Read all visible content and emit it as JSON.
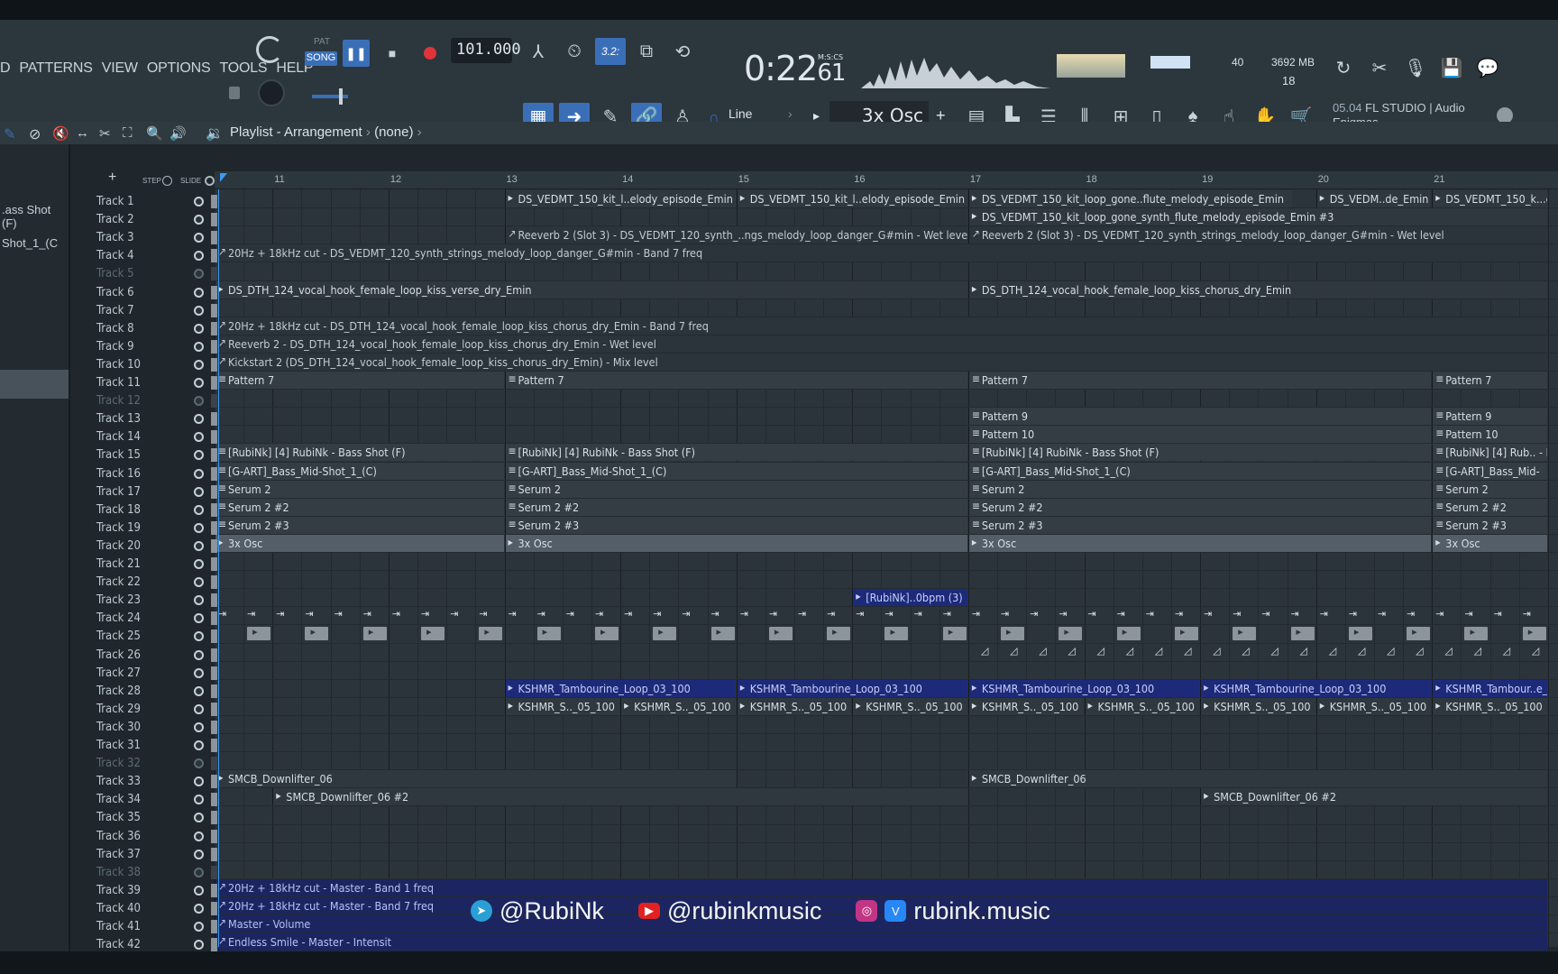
{
  "menu": [
    "D",
    "PATTERNS",
    "VIEW",
    "OPTIONS",
    "TOOLS",
    "HELP"
  ],
  "transport": {
    "pat_label": "PAT",
    "song_label": "SONG",
    "tempo": "101.000",
    "time_main": "0:22",
    "time_frac": "61",
    "time_unit": "M:S:CS"
  },
  "monitor": {
    "cpu_value": "40",
    "mem_value": "3692 MB",
    "poly_value": "18"
  },
  "snap": {
    "mode": "Line",
    "current_pattern": "3x Osc"
  },
  "hint": {
    "version": "05.04",
    "product": "FL STUDIO | Audio",
    "author": "Enigmas"
  },
  "playlist": {
    "title": "Playlist - Arrangement",
    "breadcrumb": "(none)",
    "step_label": "STEP",
    "slide_label": "SLIDE"
  },
  "browser": {
    "item1": ".ass Shot (F)",
    "item2": "Shot_1_(C"
  },
  "ruler": [
    "11",
    "12",
    "13",
    "14",
    "15",
    "16",
    "17",
    "18",
    "19",
    "20",
    "21"
  ],
  "tracks": [
    "Track 1",
    "Track 2",
    "Track 3",
    "Track 4",
    "Track 5",
    "Track 6",
    "Track 7",
    "Track 8",
    "Track 9",
    "Track 10",
    "Track 11",
    "Track 12",
    "Track 13",
    "Track 14",
    "Track 15",
    "Track 16",
    "Track 17",
    "Track 18",
    "Track 19",
    "Track 20",
    "Track 21",
    "Track 22",
    "Track 23",
    "Track 24",
    "Track 25",
    "Track 26",
    "Track 27",
    "Track 28",
    "Track 29",
    "Track 30",
    "Track 31",
    "Track 32",
    "Track 33",
    "Track 34",
    "Track 35",
    "Track 36",
    "Track 37",
    "Track 38",
    "Track 39",
    "Track 40",
    "Track 41",
    "Track 42"
  ],
  "dim_tracks": [
    5,
    12,
    32,
    38
  ],
  "clips": [
    {
      "row": 1,
      "start": 13,
      "end": 15,
      "kind": "audio",
      "label": "DS_VEDMT_150_kit_l..elody_episode_Emin"
    },
    {
      "row": 1,
      "start": 15,
      "end": 17,
      "kind": "audio",
      "label": "DS_VEDMT_150_kit_l..elody_episode_Emin"
    },
    {
      "row": 1,
      "start": 17,
      "end": 19.8,
      "kind": "audio",
      "label": "DS_VEDMT_150_kit_loop_gone..flute_melody_episode_Emin"
    },
    {
      "row": 1,
      "start": 20,
      "end": 21,
      "kind": "audio",
      "label": "DS_VEDM..de_Emin"
    },
    {
      "row": 1,
      "start": 21,
      "end": 22,
      "kind": "audio",
      "label": "DS_VEDMT_150_k...el"
    },
    {
      "row": 2,
      "start": 17,
      "end": 22,
      "kind": "audio",
      "label": "DS_VEDMT_150_kit_loop_gone_synth_flute_melody_episode_Emin #3"
    },
    {
      "row": 3,
      "start": 13,
      "end": 17,
      "kind": "auto",
      "label": "Reeverb 2 (Slot 3) - DS_VEDMT_120_synth_..ngs_melody_loop_danger_G#min - Wet level"
    },
    {
      "row": 3,
      "start": 17,
      "end": 22,
      "kind": "auto",
      "label": "Reeverb 2 (Slot 3) - DS_VEDMT_120_synth_strings_melody_loop_danger_G#min - Wet level"
    },
    {
      "row": 4,
      "start": 10.5,
      "end": 22,
      "kind": "auto",
      "label": "20Hz + 18kHz cut - DS_VEDMT_120_synth_strings_melody_loop_danger_G#min - Band 7 freq"
    },
    {
      "row": 6,
      "start": 10.5,
      "end": 17,
      "kind": "audio",
      "label": "DS_DTH_124_vocal_hook_female_loop_kiss_verse_dry_Emin"
    },
    {
      "row": 6,
      "start": 17,
      "end": 22,
      "kind": "audio",
      "label": "DS_DTH_124_vocal_hook_female_loop_kiss_chorus_dry_Emin"
    },
    {
      "row": 8,
      "start": 10.5,
      "end": 22,
      "kind": "auto",
      "label": "20Hz + 18kHz cut - DS_DTH_124_vocal_hook_female_loop_kiss_chorus_dry_Emin - Band 7 freq"
    },
    {
      "row": 9,
      "start": 10.5,
      "end": 22,
      "kind": "auto",
      "label": "Reeverb 2 - DS_DTH_124_vocal_hook_female_loop_kiss_chorus_dry_Emin - Wet level"
    },
    {
      "row": 10,
      "start": 10.5,
      "end": 22,
      "kind": "auto",
      "label": "Kickstart 2 (DS_DTH_124_vocal_hook_female_loop_kiss_chorus_dry_Emin) - Mix level"
    },
    {
      "row": 11,
      "start": 10.5,
      "end": 13,
      "kind": "patt",
      "label": "Pattern 7"
    },
    {
      "row": 11,
      "start": 13,
      "end": 17,
      "kind": "patt",
      "label": "Pattern 7"
    },
    {
      "row": 11,
      "start": 17,
      "end": 21,
      "kind": "patt",
      "label": "Pattern 7"
    },
    {
      "row": 11,
      "start": 21,
      "end": 22,
      "kind": "patt",
      "label": "Pattern 7"
    },
    {
      "row": 13,
      "start": 17,
      "end": 21,
      "kind": "patt",
      "label": "Pattern 9"
    },
    {
      "row": 13,
      "start": 21,
      "end": 22,
      "kind": "patt",
      "label": "Pattern 9"
    },
    {
      "row": 14,
      "start": 17,
      "end": 21,
      "kind": "patt",
      "label": "Pattern 10"
    },
    {
      "row": 14,
      "start": 21,
      "end": 22,
      "kind": "patt",
      "label": "Pattern 10"
    },
    {
      "row": 15,
      "start": 10.5,
      "end": 13,
      "kind": "patt",
      "label": "[RubiNk] [4] RubiNk - Bass Shot (F)"
    },
    {
      "row": 15,
      "start": 13,
      "end": 17,
      "kind": "patt",
      "label": "[RubiNk] [4] RubiNk - Bass Shot (F)"
    },
    {
      "row": 15,
      "start": 17,
      "end": 21,
      "kind": "patt",
      "label": "[RubiNk] [4] RubiNk - Bass Shot (F)"
    },
    {
      "row": 15,
      "start": 21,
      "end": 22,
      "kind": "patt",
      "label": "[RubiNk] [4] Rub.. - B"
    },
    {
      "row": 16,
      "start": 10.5,
      "end": 13,
      "kind": "patt",
      "label": "[G-ART]_Bass_Mid-Shot_1_(C)"
    },
    {
      "row": 16,
      "start": 13,
      "end": 17,
      "kind": "patt",
      "label": "[G-ART]_Bass_Mid-Shot_1_(C)"
    },
    {
      "row": 16,
      "start": 17,
      "end": 21,
      "kind": "patt",
      "label": "[G-ART]_Bass_Mid-Shot_1_(C)"
    },
    {
      "row": 16,
      "start": 21,
      "end": 22,
      "kind": "patt",
      "label": "[G-ART]_Bass_Mid-"
    },
    {
      "row": 17,
      "start": 10.5,
      "end": 13,
      "kind": "patt",
      "label": "Serum 2"
    },
    {
      "row": 17,
      "start": 13,
      "end": 17,
      "kind": "patt",
      "label": "Serum 2"
    },
    {
      "row": 17,
      "start": 17,
      "end": 21,
      "kind": "patt",
      "label": "Serum 2"
    },
    {
      "row": 17,
      "start": 21,
      "end": 22,
      "kind": "patt",
      "label": "Serum 2"
    },
    {
      "row": 18,
      "start": 10.5,
      "end": 13,
      "kind": "patt",
      "label": "Serum 2 #2"
    },
    {
      "row": 18,
      "start": 13,
      "end": 17,
      "kind": "patt",
      "label": "Serum 2 #2"
    },
    {
      "row": 18,
      "start": 17,
      "end": 21,
      "kind": "patt",
      "label": "Serum 2 #2"
    },
    {
      "row": 18,
      "start": 21,
      "end": 22,
      "kind": "patt",
      "label": "Serum 2 #2"
    },
    {
      "row": 19,
      "start": 10.5,
      "end": 13,
      "kind": "patt",
      "label": "Serum 2 #3"
    },
    {
      "row": 19,
      "start": 13,
      "end": 17,
      "kind": "patt",
      "label": "Serum 2 #3"
    },
    {
      "row": 19,
      "start": 17,
      "end": 21,
      "kind": "patt",
      "label": "Serum 2 #3"
    },
    {
      "row": 19,
      "start": 21,
      "end": 22,
      "kind": "patt",
      "label": "Serum 2 #3"
    },
    {
      "row": 20,
      "start": 10.5,
      "end": 13,
      "kind": "sel",
      "label": "3x Osc"
    },
    {
      "row": 20,
      "start": 13,
      "end": 17,
      "kind": "sel",
      "label": "3x Osc"
    },
    {
      "row": 20,
      "start": 17,
      "end": 21,
      "kind": "sel",
      "label": "3x Osc"
    },
    {
      "row": 20,
      "start": 21,
      "end": 22,
      "kind": "sel",
      "label": "3x Osc"
    },
    {
      "row": 23,
      "start": 16,
      "end": 17,
      "kind": "blue",
      "label": "[RubiNk]..0bpm (3)"
    },
    {
      "row": 28,
      "start": 13,
      "end": 15,
      "kind": "blue",
      "label": "KSHMR_Tambourine_Loop_03_100"
    },
    {
      "row": 28,
      "start": 15,
      "end": 17,
      "kind": "blue",
      "label": "KSHMR_Tambourine_Loop_03_100"
    },
    {
      "row": 28,
      "start": 17,
      "end": 19,
      "kind": "blue",
      "label": "KSHMR_Tambourine_Loop_03_100"
    },
    {
      "row": 28,
      "start": 19,
      "end": 21,
      "kind": "blue",
      "label": "KSHMR_Tambourine_Loop_03_100"
    },
    {
      "row": 28,
      "start": 21,
      "end": 22,
      "kind": "blue",
      "label": "KSHMR_Tambour..e_L"
    },
    {
      "row": 29,
      "start": 13,
      "end": 14,
      "kind": "audio",
      "label": "KSHMR_S.._05_100"
    },
    {
      "row": 29,
      "start": 14,
      "end": 15,
      "kind": "audio",
      "label": "KSHMR_S.._05_100"
    },
    {
      "row": 29,
      "start": 15,
      "end": 16,
      "kind": "audio",
      "label": "KSHMR_S.._05_100"
    },
    {
      "row": 29,
      "start": 16,
      "end": 17,
      "kind": "audio",
      "label": "KSHMR_S.._05_100"
    },
    {
      "row": 29,
      "start": 17,
      "end": 18,
      "kind": "audio",
      "label": "KSHMR_S.._05_100"
    },
    {
      "row": 29,
      "start": 18,
      "end": 19,
      "kind": "audio",
      "label": "KSHMR_S.._05_100"
    },
    {
      "row": 29,
      "start": 19,
      "end": 20,
      "kind": "audio",
      "label": "KSHMR_S.._05_100"
    },
    {
      "row": 29,
      "start": 20,
      "end": 21,
      "kind": "audio",
      "label": "KSHMR_S.._05_100"
    },
    {
      "row": 29,
      "start": 21,
      "end": 22,
      "kind": "audio",
      "label": "KSHMR_S.._05_100"
    },
    {
      "row": 33,
      "start": 10.5,
      "end": 15,
      "kind": "audio",
      "label": "SMCB_Downlifter_06"
    },
    {
      "row": 33,
      "start": 17,
      "end": 22,
      "kind": "audio",
      "label": "SMCB_Downlifter_06"
    },
    {
      "row": 34,
      "start": 11,
      "end": 17,
      "kind": "audio",
      "label": "SMCB_Downlifter_06 #2"
    },
    {
      "row": 34,
      "start": 19,
      "end": 22,
      "kind": "audio",
      "label": "SMCB_Downlifter_06 #2"
    },
    {
      "row": 39,
      "start": 10.5,
      "end": 22,
      "kind": "blueauto",
      "label": "20Hz + 18kHz cut - Master - Band 1 freq"
    },
    {
      "row": 40,
      "start": 10.5,
      "end": 22,
      "kind": "blueauto",
      "label": "20Hz + 18kHz cut - Master - Band 7 freq"
    },
    {
      "row": 41,
      "start": 10.5,
      "end": 22,
      "kind": "blueauto",
      "label": "Master - Volume"
    },
    {
      "row": 42,
      "start": 10.5,
      "end": 22,
      "kind": "blueauto",
      "label": "Endless Smile - Master - Intensit"
    }
  ],
  "social": {
    "telegram": "@RubiNk",
    "youtube": "@rubinkmusic",
    "vk_instagram": "rubink.music"
  },
  "colors": {
    "accent": "#3a6fb8",
    "clip_blue": "#1d2a7a",
    "record": "#e0333a"
  }
}
